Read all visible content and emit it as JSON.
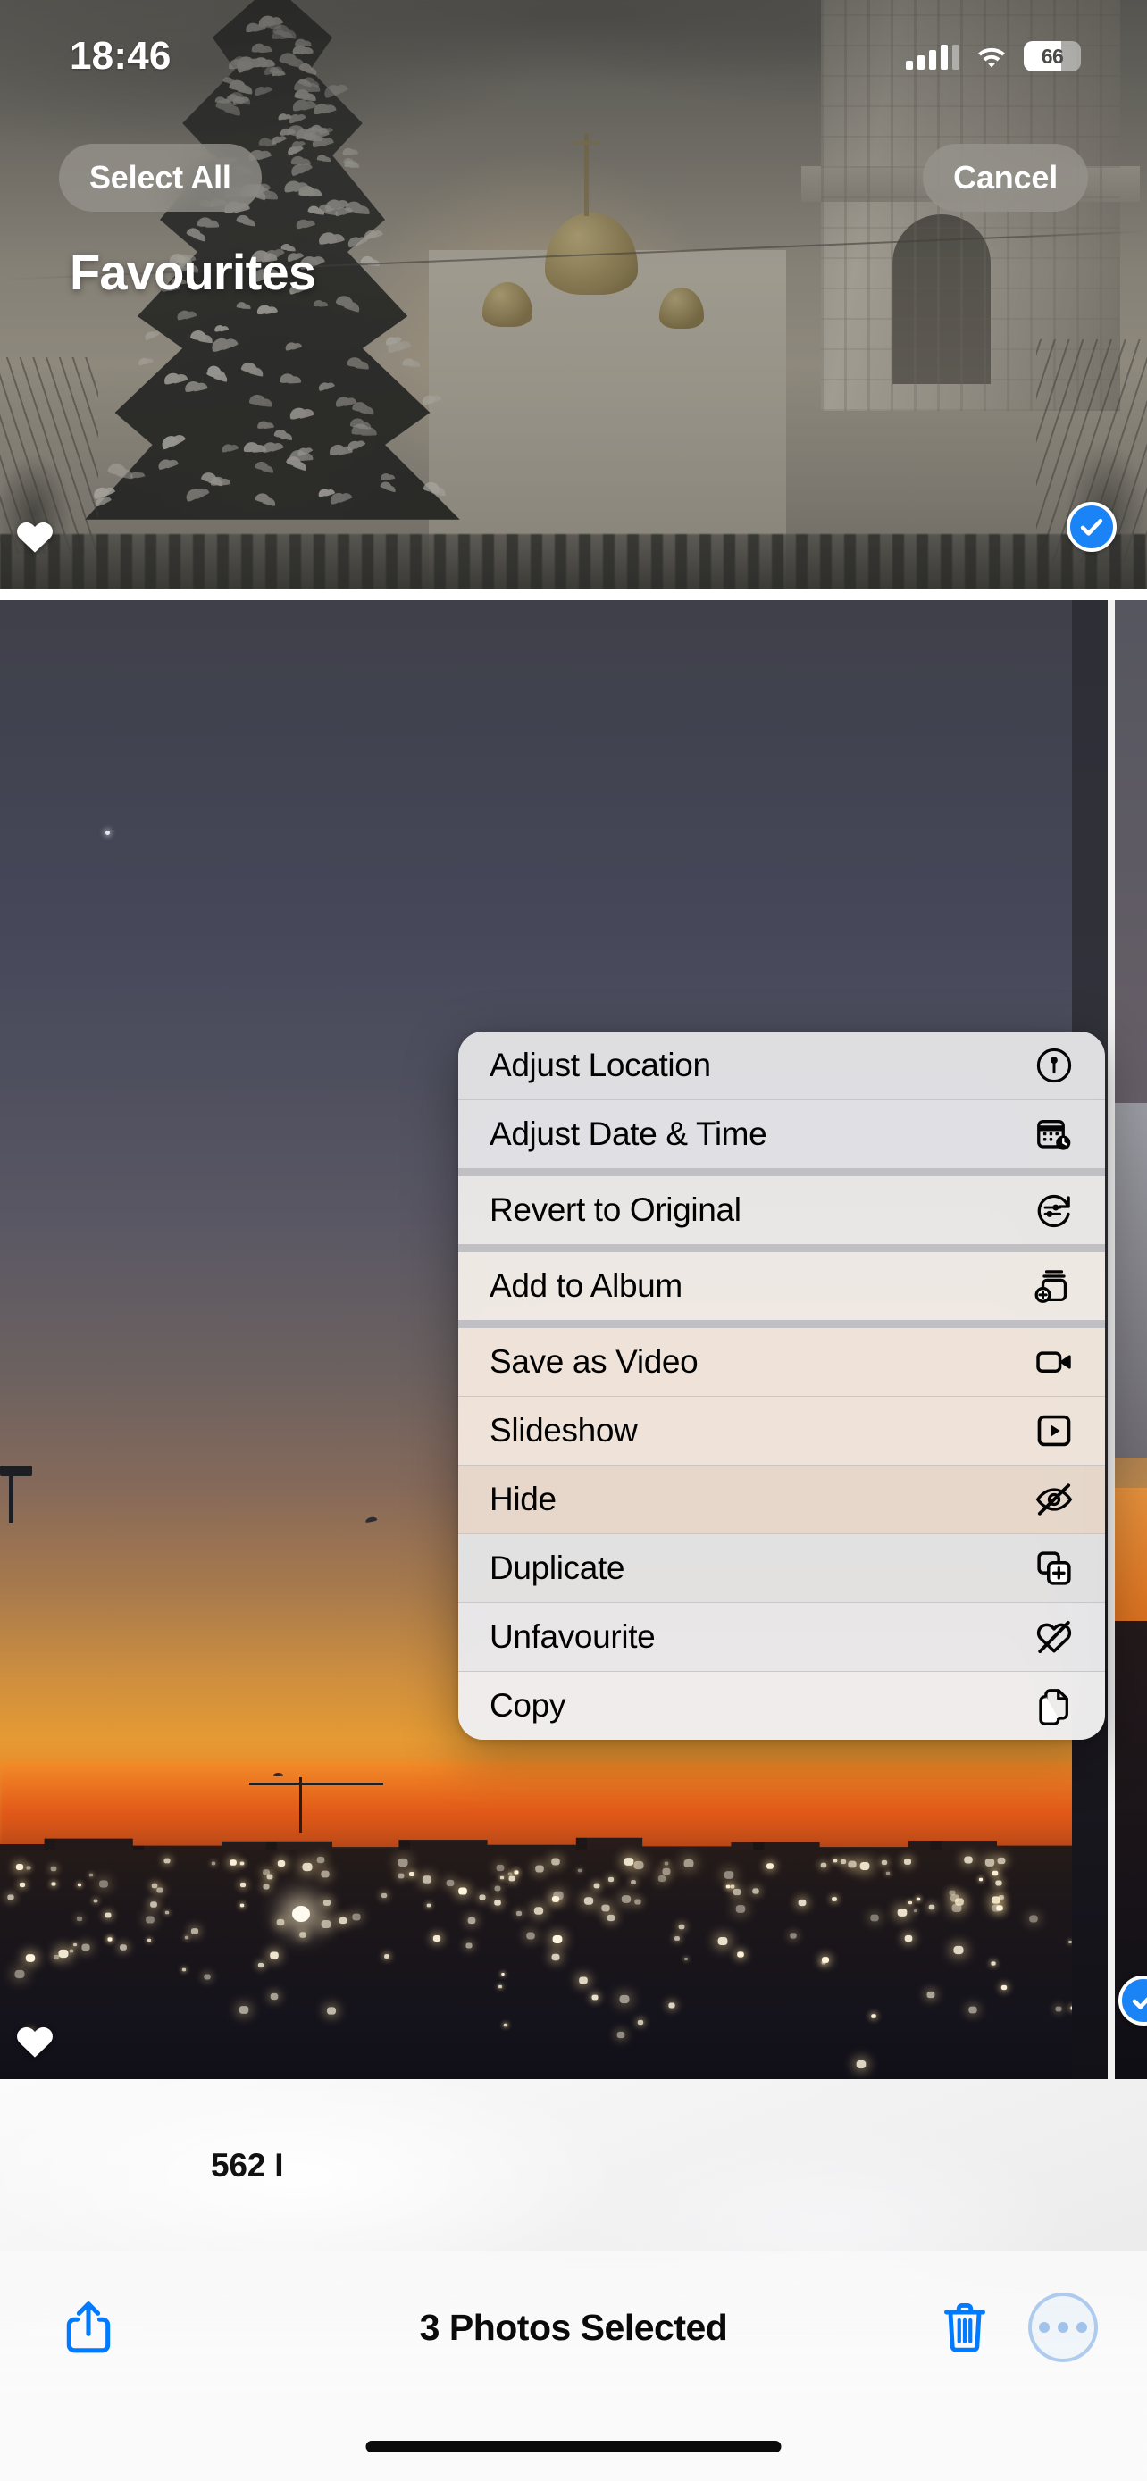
{
  "status_bar": {
    "time": "18:46",
    "cellular_icon": "cellular-signal-icon",
    "wifi_icon": "wifi-icon",
    "battery_icon": "battery-icon",
    "battery_percent": "66"
  },
  "nav": {
    "select_all_label": "Select All",
    "cancel_label": "Cancel",
    "album_title": "Favourites"
  },
  "grid": {
    "count_label": "562 I",
    "photos": [
      {
        "name": "photo-cathedral-christmas-tree",
        "favourite": true,
        "selected": true
      },
      {
        "name": "photo-sunset-cityscape",
        "favourite": true,
        "selected": false
      },
      {
        "name": "photo-right-strip",
        "favourite": false,
        "selected": true
      },
      {
        "name": "photo-bottom-white",
        "favourite": false,
        "selected": false
      }
    ]
  },
  "context_menu": {
    "items": [
      {
        "label": "Adjust Location",
        "icon": "location-pin-circle-icon",
        "group": 0
      },
      {
        "label": "Adjust Date & Time",
        "icon": "calendar-clock-icon",
        "group": 0
      },
      {
        "label": "Revert to Original",
        "icon": "revert-sliders-icon",
        "group": 1
      },
      {
        "label": "Add to Album",
        "icon": "add-to-album-icon",
        "group": 1
      },
      {
        "label": "Save as Video",
        "icon": "video-camera-icon",
        "group": 2
      },
      {
        "label": "Slideshow",
        "icon": "play-square-icon",
        "group": 2
      },
      {
        "label": "Hide",
        "icon": "eye-slash-icon",
        "group": 2
      },
      {
        "label": "Duplicate",
        "icon": "duplicate-icon",
        "group": 2
      },
      {
        "label": "Unfavourite",
        "icon": "heart-slash-icon",
        "group": 2
      },
      {
        "label": "Copy",
        "icon": "copy-documents-icon",
        "group": 2
      }
    ]
  },
  "toolbar": {
    "share_icon": "share-icon",
    "status_text": "3 Photos Selected",
    "delete_icon": "trash-icon",
    "more_icon": "more-ellipsis-icon"
  },
  "colors": {
    "accent_blue": "#007aff",
    "selection_blue": "#1a84f7",
    "more_active_blue": "#9dc1eb"
  }
}
